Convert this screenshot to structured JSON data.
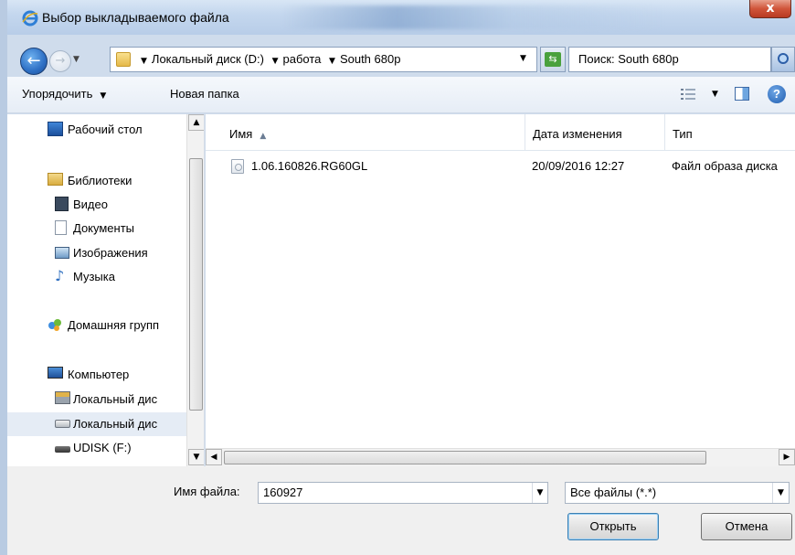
{
  "window": {
    "title": "Выбор выкладываемого файла",
    "close_label": "x"
  },
  "nav": {
    "breadcrumbs": [
      "Локальный диск (D:)",
      "работа",
      "South 680p"
    ],
    "search_placeholder": "Поиск: South 680p"
  },
  "toolbar": {
    "organize_label": "Упорядочить",
    "new_folder_label": "Новая папка"
  },
  "sidebar": {
    "items": [
      {
        "label": "Рабочий стол",
        "icon": "desktop-icon"
      },
      {
        "label": "Библиотеки",
        "icon": "libraries-icon"
      },
      {
        "label": "Видео",
        "icon": "video-icon"
      },
      {
        "label": "Документы",
        "icon": "documents-icon"
      },
      {
        "label": "Изображения",
        "icon": "pictures-icon"
      },
      {
        "label": "Музыка",
        "icon": "music-icon"
      },
      {
        "label": "Домашняя групп",
        "icon": "homegroup-icon"
      },
      {
        "label": "Компьютер",
        "icon": "computer-icon"
      },
      {
        "label": "Локальный дис",
        "icon": "system-drive-icon"
      },
      {
        "label": "Локальный дис",
        "icon": "drive-icon"
      },
      {
        "label": "UDISK (F:)",
        "icon": "usb-drive-icon"
      }
    ]
  },
  "files": {
    "columns": [
      "Имя",
      "Дата изменения",
      "Тип"
    ],
    "rows": [
      {
        "name": "1.06.160826.RG60GL",
        "date": "20/09/2016 12:27",
        "type": "Файл образа диска"
      }
    ]
  },
  "bottom": {
    "filename_label": "Имя файла:",
    "filename_value": "160927",
    "filter_value": "Все файлы (*.*)",
    "open_label": "Открыть",
    "cancel_label": "Отмена"
  }
}
